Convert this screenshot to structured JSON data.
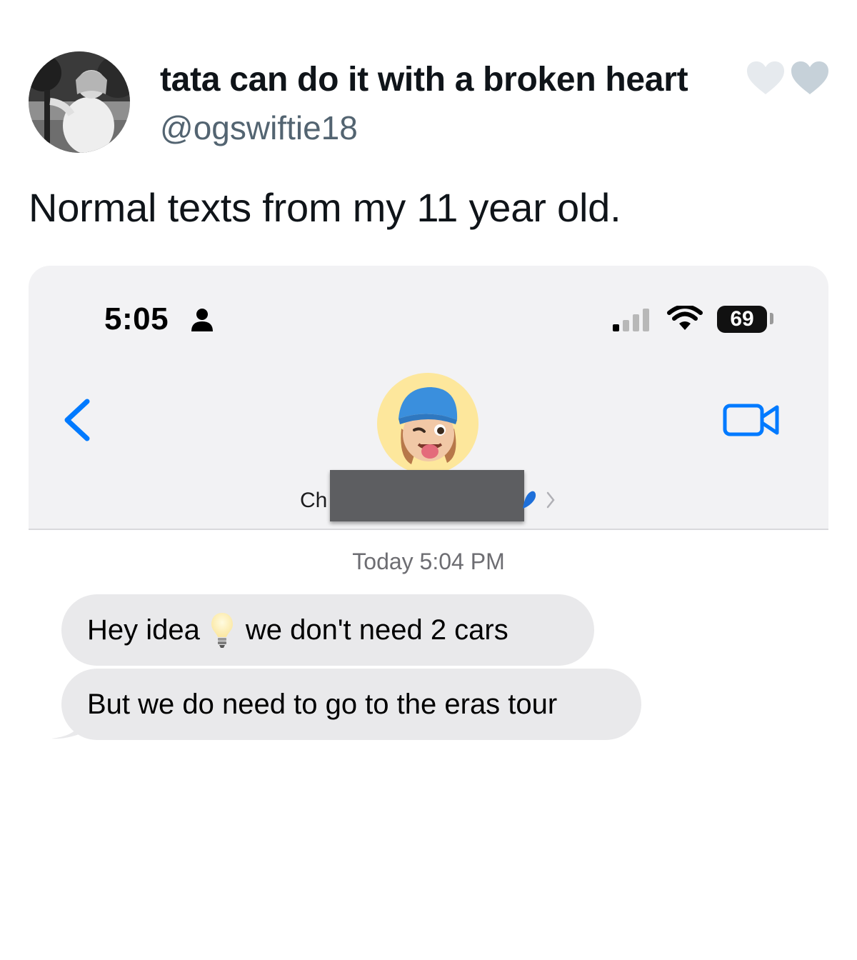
{
  "tweet": {
    "display_name": "tata can do it with a broken heart",
    "handle": "@ogswiftie18",
    "text": "Normal texts from my 11 year old.",
    "name_emoji": [
      "white-heart-icon",
      "grey-heart-icon"
    ]
  },
  "phone": {
    "status_bar": {
      "time": "5:05",
      "battery": "69"
    },
    "nav": {
      "contact_name_visible": "Ch"
    },
    "conversation": {
      "timestamp": "Today 5:04 PM",
      "messages": [
        {
          "before_emoji": "Hey idea",
          "emoji": "light-bulb-icon",
          "after_emoji": "we don't need 2 cars"
        },
        {
          "text": "But we do need to go to the eras tour"
        }
      ]
    }
  },
  "colors": {
    "ios_blue": "#007aff",
    "bubble_grey": "#e9e9eb",
    "header_grey": "#f2f2f4",
    "handle_grey": "#536471",
    "avatar_yellow": "#fde79c"
  }
}
